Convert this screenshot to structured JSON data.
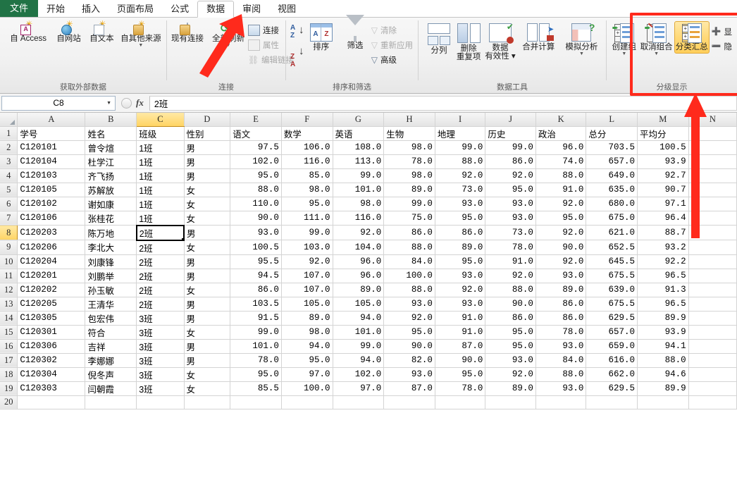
{
  "ribbon": {
    "tabs": [
      {
        "label": "文件",
        "active": false,
        "file": true
      },
      {
        "label": "开始",
        "active": false
      },
      {
        "label": "插入",
        "active": false
      },
      {
        "label": "页面布局",
        "active": false
      },
      {
        "label": "公式",
        "active": false
      },
      {
        "label": "数据",
        "active": true
      },
      {
        "label": "审阅",
        "active": false
      },
      {
        "label": "视图",
        "active": false
      }
    ],
    "groups": [
      {
        "title": "获取外部数据",
        "buttons": [
          "自 Access",
          "自网站",
          "自文本",
          "自其他来源"
        ]
      },
      {
        "title": "连接",
        "big": "全部刷新",
        "small": [
          "连接",
          "属性",
          "编辑链接"
        ]
      },
      {
        "title": "排序和筛选",
        "sort": "排序",
        "filter": "筛选",
        "small": [
          "清除",
          "重新应用",
          "高级"
        ]
      },
      {
        "title": "数据工具",
        "buttons": [
          "分列",
          "删除",
          "重复项",
          "数据",
          "有效性",
          "合并计算",
          "模拟分析"
        ]
      },
      {
        "title": "分级显示",
        "buttons": [
          "创建组",
          "取消组合",
          "分类汇总"
        ],
        "small": [
          "显",
          "隐"
        ]
      }
    ]
  },
  "formula_bar": {
    "name_box": "C8",
    "value": "2班"
  },
  "sheet": {
    "columns": [
      "A",
      "B",
      "C",
      "D",
      "E",
      "F",
      "G",
      "H",
      "I",
      "J",
      "K",
      "L",
      "M",
      "N"
    ],
    "highlighted_column": "C",
    "highlighted_row": 8,
    "active_cell": "C8",
    "headers": [
      "学号",
      "姓名",
      "班级",
      "性别",
      "语文",
      "数学",
      "英语",
      "生物",
      "地理",
      "历史",
      "政治",
      "总分",
      "平均分"
    ],
    "rows": [
      {
        "r": 2,
        "c": [
          "C120101",
          "曾令煊",
          "1班",
          "男",
          "97.5",
          "106.0",
          "108.0",
          "98.0",
          "99.0",
          "99.0",
          "96.0",
          "703.5",
          "100.5"
        ]
      },
      {
        "r": 3,
        "c": [
          "C120104",
          "杜学江",
          "1班",
          "男",
          "102.0",
          "116.0",
          "113.0",
          "78.0",
          "88.0",
          "86.0",
          "74.0",
          "657.0",
          "93.9"
        ]
      },
      {
        "r": 4,
        "c": [
          "C120103",
          "齐飞扬",
          "1班",
          "男",
          "95.0",
          "85.0",
          "99.0",
          "98.0",
          "92.0",
          "92.0",
          "88.0",
          "649.0",
          "92.7"
        ]
      },
      {
        "r": 5,
        "c": [
          "C120105",
          "苏解放",
          "1班",
          "女",
          "88.0",
          "98.0",
          "101.0",
          "89.0",
          "73.0",
          "95.0",
          "91.0",
          "635.0",
          "90.7"
        ]
      },
      {
        "r": 6,
        "c": [
          "C120102",
          "谢如康",
          "1班",
          "女",
          "110.0",
          "95.0",
          "98.0",
          "99.0",
          "93.0",
          "93.0",
          "92.0",
          "680.0",
          "97.1"
        ]
      },
      {
        "r": 7,
        "c": [
          "C120106",
          "张桂花",
          "1班",
          "女",
          "90.0",
          "111.0",
          "116.0",
          "75.0",
          "95.0",
          "93.0",
          "95.0",
          "675.0",
          "96.4"
        ]
      },
      {
        "r": 8,
        "c": [
          "C120203",
          "陈万地",
          "2班",
          "男",
          "93.0",
          "99.0",
          "92.0",
          "86.0",
          "86.0",
          "73.0",
          "92.0",
          "621.0",
          "88.7"
        ]
      },
      {
        "r": 9,
        "c": [
          "C120206",
          "李北大",
          "2班",
          "女",
          "100.5",
          "103.0",
          "104.0",
          "88.0",
          "89.0",
          "78.0",
          "90.0",
          "652.5",
          "93.2"
        ]
      },
      {
        "r": 10,
        "c": [
          "C120204",
          "刘康锋",
          "2班",
          "男",
          "95.5",
          "92.0",
          "96.0",
          "84.0",
          "95.0",
          "91.0",
          "92.0",
          "645.5",
          "92.2"
        ]
      },
      {
        "r": 11,
        "c": [
          "C120201",
          "刘鹏举",
          "2班",
          "男",
          "94.5",
          "107.0",
          "96.0",
          "100.0",
          "93.0",
          "92.0",
          "93.0",
          "675.5",
          "96.5"
        ]
      },
      {
        "r": 12,
        "c": [
          "C120202",
          "孙玉敏",
          "2班",
          "女",
          "86.0",
          "107.0",
          "89.0",
          "88.0",
          "92.0",
          "88.0",
          "89.0",
          "639.0",
          "91.3"
        ]
      },
      {
        "r": 13,
        "c": [
          "C120205",
          "王清华",
          "2班",
          "男",
          "103.5",
          "105.0",
          "105.0",
          "93.0",
          "93.0",
          "90.0",
          "86.0",
          "675.5",
          "96.5"
        ]
      },
      {
        "r": 14,
        "c": [
          "C120305",
          "包宏伟",
          "3班",
          "男",
          "91.5",
          "89.0",
          "94.0",
          "92.0",
          "91.0",
          "86.0",
          "86.0",
          "629.5",
          "89.9"
        ]
      },
      {
        "r": 15,
        "c": [
          "C120301",
          "符合",
          "3班",
          "女",
          "99.0",
          "98.0",
          "101.0",
          "95.0",
          "91.0",
          "95.0",
          "78.0",
          "657.0",
          "93.9"
        ]
      },
      {
        "r": 16,
        "c": [
          "C120306",
          "吉祥",
          "3班",
          "男",
          "101.0",
          "94.0",
          "99.0",
          "90.0",
          "87.0",
          "95.0",
          "93.0",
          "659.0",
          "94.1"
        ]
      },
      {
        "r": 17,
        "c": [
          "C120302",
          "李娜娜",
          "3班",
          "男",
          "78.0",
          "95.0",
          "94.0",
          "82.0",
          "90.0",
          "93.0",
          "84.0",
          "616.0",
          "88.0"
        ]
      },
      {
        "r": 18,
        "c": [
          "C120304",
          "倪冬声",
          "3班",
          "女",
          "95.0",
          "97.0",
          "102.0",
          "93.0",
          "95.0",
          "92.0",
          "88.0",
          "662.0",
          "94.6"
        ]
      },
      {
        "r": 19,
        "c": [
          "C120303",
          "闫朝霞",
          "3班",
          "女",
          "85.5",
          "100.0",
          "97.0",
          "87.0",
          "78.0",
          "89.0",
          "93.0",
          "629.5",
          "89.9"
        ]
      },
      {
        "r": 20,
        "c": [
          "",
          "",
          "",
          "",
          "",
          "",
          "",
          "",
          "",
          "",
          "",
          "",
          ""
        ]
      }
    ]
  },
  "annotations": {
    "accent_color": "#ff2a1c",
    "arrow_to_data_tab": "arrow-up-right",
    "arrow_to_outline_group": "arrow-up",
    "highlight_box": "分级显示"
  }
}
